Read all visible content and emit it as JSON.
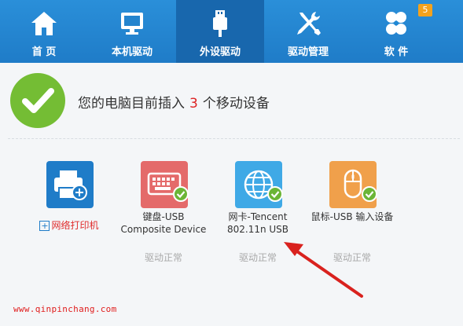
{
  "nav": {
    "tabs": [
      {
        "label": "首 页",
        "icon": "home-icon"
      },
      {
        "label": "本机驱动",
        "icon": "monitor-icon"
      },
      {
        "label": "外设驱动",
        "icon": "usb-icon"
      },
      {
        "label": "驱动管理",
        "icon": "tools-icon"
      },
      {
        "label": "软 件",
        "icon": "software-icon",
        "badge": "5"
      }
    ],
    "active_index": 2
  },
  "summary": {
    "prefix": "您的电脑目前插入",
    "count": "3",
    "suffix": "个移动设备"
  },
  "devices": [
    {
      "name_line1": "",
      "name_line2": "",
      "link_label": "网络打印机",
      "status": "",
      "icon": "printer-icon",
      "color": "#1f7cc8"
    },
    {
      "name_line1": "键盘-USB",
      "name_line2": "Composite Device",
      "status": "驱动正常",
      "icon": "keyboard-icon",
      "color": "#e46a6a"
    },
    {
      "name_line1": "网卡-Tencent",
      "name_line2": "802.11n USB",
      "status": "驱动正常",
      "icon": "globe-icon",
      "color": "#3fa9e6"
    },
    {
      "name_line1": "鼠标-USB 输入设备",
      "name_line2": "",
      "status": "驱动正常",
      "icon": "mouse-icon",
      "color": "#f0a04b"
    }
  ],
  "watermark": "www.qinpinchang.com",
  "colors": {
    "nav_bg": "#2088d4",
    "nav_active": "#1867ad",
    "accent_green": "#74bd34",
    "count_red": "#d22222",
    "arrow_red": "#d9221e"
  }
}
